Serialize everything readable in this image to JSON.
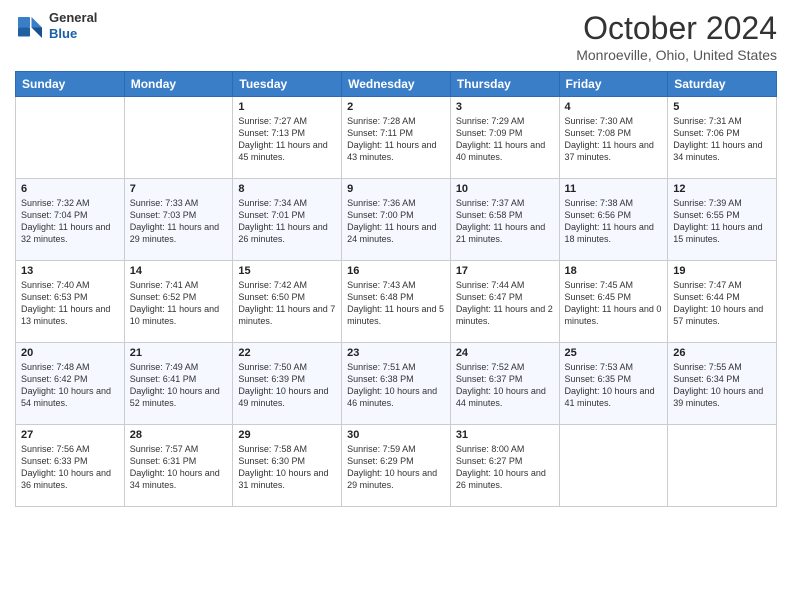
{
  "header": {
    "logo_general": "General",
    "logo_blue": "Blue",
    "month_title": "October 2024",
    "location": "Monroeville, Ohio, United States"
  },
  "weekdays": [
    "Sunday",
    "Monday",
    "Tuesday",
    "Wednesday",
    "Thursday",
    "Friday",
    "Saturday"
  ],
  "weeks": [
    [
      {
        "day": "",
        "sunrise": "",
        "sunset": "",
        "daylight": ""
      },
      {
        "day": "",
        "sunrise": "",
        "sunset": "",
        "daylight": ""
      },
      {
        "day": "1",
        "sunrise": "Sunrise: 7:27 AM",
        "sunset": "Sunset: 7:13 PM",
        "daylight": "Daylight: 11 hours and 45 minutes."
      },
      {
        "day": "2",
        "sunrise": "Sunrise: 7:28 AM",
        "sunset": "Sunset: 7:11 PM",
        "daylight": "Daylight: 11 hours and 43 minutes."
      },
      {
        "day": "3",
        "sunrise": "Sunrise: 7:29 AM",
        "sunset": "Sunset: 7:09 PM",
        "daylight": "Daylight: 11 hours and 40 minutes."
      },
      {
        "day": "4",
        "sunrise": "Sunrise: 7:30 AM",
        "sunset": "Sunset: 7:08 PM",
        "daylight": "Daylight: 11 hours and 37 minutes."
      },
      {
        "day": "5",
        "sunrise": "Sunrise: 7:31 AM",
        "sunset": "Sunset: 7:06 PM",
        "daylight": "Daylight: 11 hours and 34 minutes."
      }
    ],
    [
      {
        "day": "6",
        "sunrise": "Sunrise: 7:32 AM",
        "sunset": "Sunset: 7:04 PM",
        "daylight": "Daylight: 11 hours and 32 minutes."
      },
      {
        "day": "7",
        "sunrise": "Sunrise: 7:33 AM",
        "sunset": "Sunset: 7:03 PM",
        "daylight": "Daylight: 11 hours and 29 minutes."
      },
      {
        "day": "8",
        "sunrise": "Sunrise: 7:34 AM",
        "sunset": "Sunset: 7:01 PM",
        "daylight": "Daylight: 11 hours and 26 minutes."
      },
      {
        "day": "9",
        "sunrise": "Sunrise: 7:36 AM",
        "sunset": "Sunset: 7:00 PM",
        "daylight": "Daylight: 11 hours and 24 minutes."
      },
      {
        "day": "10",
        "sunrise": "Sunrise: 7:37 AM",
        "sunset": "Sunset: 6:58 PM",
        "daylight": "Daylight: 11 hours and 21 minutes."
      },
      {
        "day": "11",
        "sunrise": "Sunrise: 7:38 AM",
        "sunset": "Sunset: 6:56 PM",
        "daylight": "Daylight: 11 hours and 18 minutes."
      },
      {
        "day": "12",
        "sunrise": "Sunrise: 7:39 AM",
        "sunset": "Sunset: 6:55 PM",
        "daylight": "Daylight: 11 hours and 15 minutes."
      }
    ],
    [
      {
        "day": "13",
        "sunrise": "Sunrise: 7:40 AM",
        "sunset": "Sunset: 6:53 PM",
        "daylight": "Daylight: 11 hours and 13 minutes."
      },
      {
        "day": "14",
        "sunrise": "Sunrise: 7:41 AM",
        "sunset": "Sunset: 6:52 PM",
        "daylight": "Daylight: 11 hours and 10 minutes."
      },
      {
        "day": "15",
        "sunrise": "Sunrise: 7:42 AM",
        "sunset": "Sunset: 6:50 PM",
        "daylight": "Daylight: 11 hours and 7 minutes."
      },
      {
        "day": "16",
        "sunrise": "Sunrise: 7:43 AM",
        "sunset": "Sunset: 6:48 PM",
        "daylight": "Daylight: 11 hours and 5 minutes."
      },
      {
        "day": "17",
        "sunrise": "Sunrise: 7:44 AM",
        "sunset": "Sunset: 6:47 PM",
        "daylight": "Daylight: 11 hours and 2 minutes."
      },
      {
        "day": "18",
        "sunrise": "Sunrise: 7:45 AM",
        "sunset": "Sunset: 6:45 PM",
        "daylight": "Daylight: 11 hours and 0 minutes."
      },
      {
        "day": "19",
        "sunrise": "Sunrise: 7:47 AM",
        "sunset": "Sunset: 6:44 PM",
        "daylight": "Daylight: 10 hours and 57 minutes."
      }
    ],
    [
      {
        "day": "20",
        "sunrise": "Sunrise: 7:48 AM",
        "sunset": "Sunset: 6:42 PM",
        "daylight": "Daylight: 10 hours and 54 minutes."
      },
      {
        "day": "21",
        "sunrise": "Sunrise: 7:49 AM",
        "sunset": "Sunset: 6:41 PM",
        "daylight": "Daylight: 10 hours and 52 minutes."
      },
      {
        "day": "22",
        "sunrise": "Sunrise: 7:50 AM",
        "sunset": "Sunset: 6:39 PM",
        "daylight": "Daylight: 10 hours and 49 minutes."
      },
      {
        "day": "23",
        "sunrise": "Sunrise: 7:51 AM",
        "sunset": "Sunset: 6:38 PM",
        "daylight": "Daylight: 10 hours and 46 minutes."
      },
      {
        "day": "24",
        "sunrise": "Sunrise: 7:52 AM",
        "sunset": "Sunset: 6:37 PM",
        "daylight": "Daylight: 10 hours and 44 minutes."
      },
      {
        "day": "25",
        "sunrise": "Sunrise: 7:53 AM",
        "sunset": "Sunset: 6:35 PM",
        "daylight": "Daylight: 10 hours and 41 minutes."
      },
      {
        "day": "26",
        "sunrise": "Sunrise: 7:55 AM",
        "sunset": "Sunset: 6:34 PM",
        "daylight": "Daylight: 10 hours and 39 minutes."
      }
    ],
    [
      {
        "day": "27",
        "sunrise": "Sunrise: 7:56 AM",
        "sunset": "Sunset: 6:33 PM",
        "daylight": "Daylight: 10 hours and 36 minutes."
      },
      {
        "day": "28",
        "sunrise": "Sunrise: 7:57 AM",
        "sunset": "Sunset: 6:31 PM",
        "daylight": "Daylight: 10 hours and 34 minutes."
      },
      {
        "day": "29",
        "sunrise": "Sunrise: 7:58 AM",
        "sunset": "Sunset: 6:30 PM",
        "daylight": "Daylight: 10 hours and 31 minutes."
      },
      {
        "day": "30",
        "sunrise": "Sunrise: 7:59 AM",
        "sunset": "Sunset: 6:29 PM",
        "daylight": "Daylight: 10 hours and 29 minutes."
      },
      {
        "day": "31",
        "sunrise": "Sunrise: 8:00 AM",
        "sunset": "Sunset: 6:27 PM",
        "daylight": "Daylight: 10 hours and 26 minutes."
      },
      {
        "day": "",
        "sunrise": "",
        "sunset": "",
        "daylight": ""
      },
      {
        "day": "",
        "sunrise": "",
        "sunset": "",
        "daylight": ""
      }
    ]
  ]
}
